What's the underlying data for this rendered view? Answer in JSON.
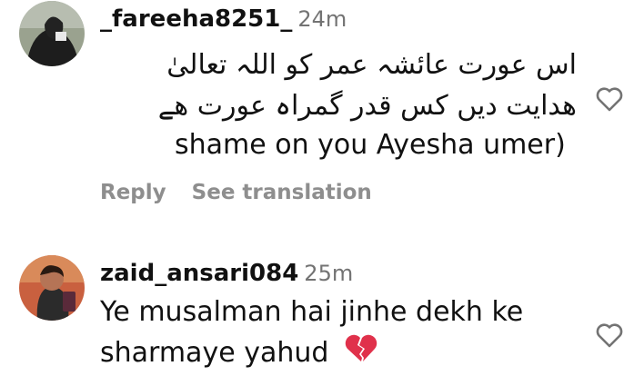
{
  "comments": [
    {
      "username": "_fareeha8251_",
      "time": "24m",
      "text_lines": [
        "اس عورت عائشہ عمر کو اللہ تعالیٰ",
        "ھدایت دیں کس قدر گمراہ عورت ھے",
        "shame on you Ayesha umer)"
      ],
      "actions": {
        "reply": "Reply",
        "translate": "See translation"
      },
      "icons": {
        "avatar": "avatar",
        "like": "heart-outline-icon"
      }
    },
    {
      "username": "zaid_ansari084",
      "time": "25m",
      "text_lines": [
        "Ye musalman hai jinhe dekh ke",
        "sharmaye yahud"
      ],
      "emoji": "broken-heart",
      "icons": {
        "avatar": "avatar",
        "like": "heart-outline-icon"
      }
    }
  ],
  "colors": {
    "username": "#111111",
    "meta": "#737373",
    "actions": "#8e8e8e",
    "broken_heart": "#e0314b"
  }
}
